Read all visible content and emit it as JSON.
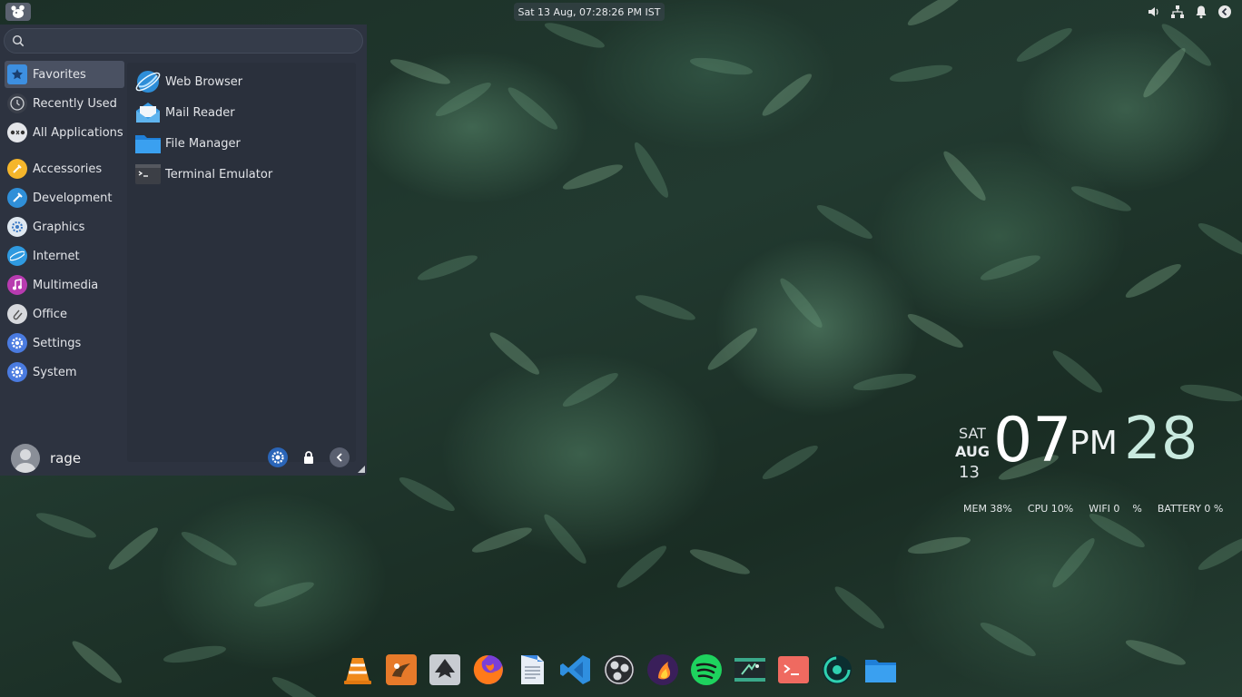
{
  "top_panel": {
    "clock_text": "Sat 13 Aug, 07:28:26 PM IST",
    "tray": [
      {
        "icon": "volume-icon"
      },
      {
        "icon": "network-icon"
      },
      {
        "icon": "notification-bell-icon"
      },
      {
        "icon": "power-icon"
      }
    ]
  },
  "menu": {
    "search": {
      "value": "",
      "placeholder": ""
    },
    "categories": [
      {
        "label": "Favorites",
        "icon": "star-icon",
        "color": "#3d8fe0",
        "active": true
      },
      {
        "label": "Recently Used",
        "icon": "clock-icon",
        "color": "#3a3f4a"
      },
      {
        "label": "All Applications",
        "icon": "all-apps-icon",
        "color": "#e4e6ea"
      },
      {
        "label": "Accessories",
        "icon": "accessories-icon",
        "color": "#f5b62b"
      },
      {
        "label": "Development",
        "icon": "development-icon",
        "color": "#2f8fd8"
      },
      {
        "label": "Graphics",
        "icon": "graphics-icon",
        "color": "#dfe8f0"
      },
      {
        "label": "Internet",
        "icon": "internet-icon",
        "color": "#2f9ae0"
      },
      {
        "label": "Multimedia",
        "icon": "multimedia-icon",
        "color": "#b83bb0"
      },
      {
        "label": "Office",
        "icon": "office-icon",
        "color": "#d7d9dd"
      },
      {
        "label": "Settings",
        "icon": "settings-icon",
        "color": "#4a7be0"
      },
      {
        "label": "System",
        "icon": "system-icon",
        "color": "#4a7be0"
      }
    ],
    "apps": [
      {
        "label": "Web Browser",
        "icon": "web-browser-icon"
      },
      {
        "label": "Mail Reader",
        "icon": "mail-reader-icon"
      },
      {
        "label": "File Manager",
        "icon": "file-manager-icon"
      },
      {
        "label": "Terminal Emulator",
        "icon": "terminal-icon"
      }
    ],
    "footer": {
      "username": "rage",
      "buttons": [
        "settings-manager-icon",
        "lock-icon",
        "back-icon"
      ]
    }
  },
  "conky": {
    "day": "SAT",
    "month": "AUG",
    "date": "13",
    "hour": "07",
    "ampm": "PM",
    "minute": "28",
    "stats": [
      "MEM 38%",
      "CPU 10%",
      "WIFI 0    %",
      "BATTERY 0 %"
    ]
  },
  "dock": [
    {
      "name": "vlc-icon"
    },
    {
      "name": "gimp-icon"
    },
    {
      "name": "inkscape-icon"
    },
    {
      "name": "firefox-icon"
    },
    {
      "name": "text-editor-icon"
    },
    {
      "name": "vscode-icon"
    },
    {
      "name": "obs-icon"
    },
    {
      "name": "kingsoft-icon"
    },
    {
      "name": "spotify-icon"
    },
    {
      "name": "kdenlive-icon"
    },
    {
      "name": "terminal-dock-icon"
    },
    {
      "name": "gitkraken-icon"
    },
    {
      "name": "files-icon"
    }
  ]
}
